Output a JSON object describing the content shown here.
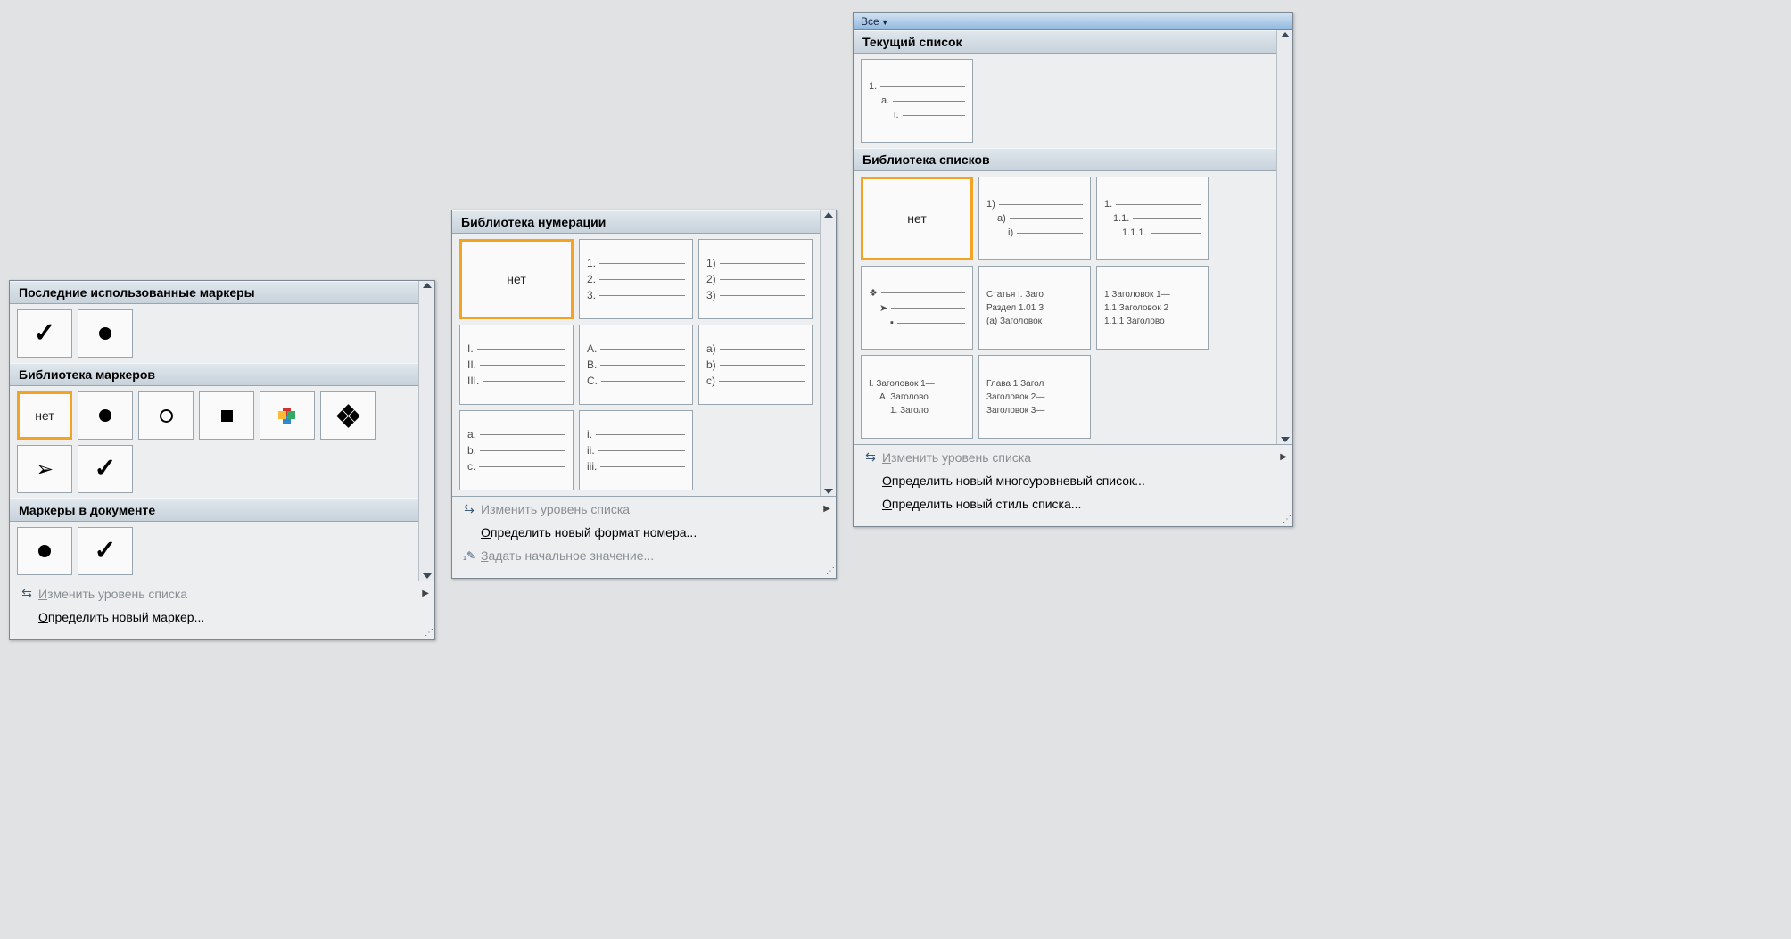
{
  "bullets": {
    "sections": {
      "recent": "Последние использованные маркеры",
      "library": "Библиотека маркеров",
      "document": "Маркеры в документе"
    },
    "none_label": "нет",
    "menu": {
      "change_level": "зменить уровень списка",
      "define_new": "пределить новый маркер..."
    }
  },
  "numbering": {
    "sections": {
      "library": "Библиотека нумерации"
    },
    "none_label": "нет",
    "items": {
      "r1c2": [
        "1.",
        "2.",
        "3."
      ],
      "r1c3": [
        "1)",
        "2)",
        "3)"
      ],
      "r2c1": [
        "I.",
        "II.",
        "III."
      ],
      "r2c2": [
        "A.",
        "B.",
        "C."
      ],
      "r2c3": [
        "a)",
        "b)",
        "c)"
      ],
      "r3c1": [
        "a.",
        "b.",
        "c."
      ],
      "r3c2": [
        "i.",
        "ii.",
        "iii."
      ]
    },
    "menu": {
      "change_level": "зменить уровень списка",
      "define_new": "пределить новый формат номера...",
      "set_start": "адать начальное значение..."
    }
  },
  "lists": {
    "filter": "Все",
    "sections": {
      "current": "Текущий список",
      "library": "Библиотека списков"
    },
    "current_item": [
      "1.",
      "a.",
      "i."
    ],
    "none_label": "нет",
    "lib": {
      "r1c2": [
        "1)",
        "a)",
        "i)"
      ],
      "r1c3": [
        "1.",
        "1.1.",
        "1.1.1."
      ],
      "r2c1": [
        "❖",
        "➤",
        "▪"
      ],
      "r2c2": [
        "Статья I. Заго",
        "Раздел 1.01 З",
        "(a) Заголовок"
      ],
      "r2c3": [
        "1 Заголовок 1—",
        "1.1 Заголовок 2",
        "1.1.1 Заголово"
      ],
      "r3c1": [
        "I. Заголовок 1—",
        "A. Заголово",
        "1. Заголо"
      ],
      "r3c2": [
        "Глава 1 Загол",
        "Заголовок 2—",
        "Заголовок 3—"
      ]
    },
    "menu": {
      "change_level": "зменить уровень списка",
      "define_new_ml": "пределить новый многоуровневый список...",
      "define_new_style": "пределить новый стиль списка..."
    }
  }
}
